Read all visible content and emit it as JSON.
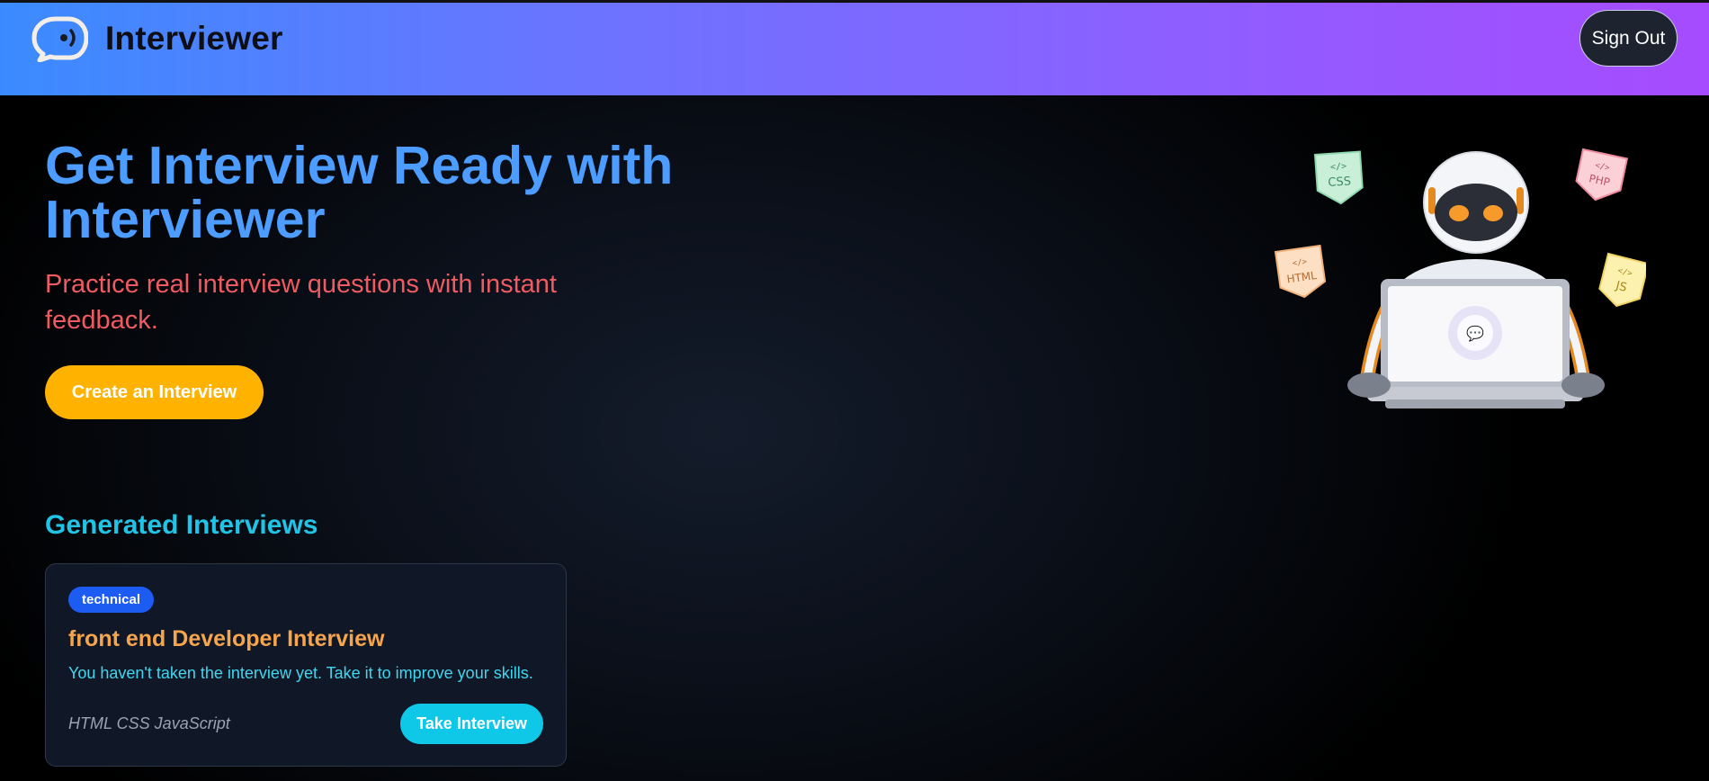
{
  "header": {
    "brand": "Interviewer",
    "sign_out_label": "Sign Out",
    "logo_icon": "chat-bubble-icon"
  },
  "hero": {
    "title": "Get Interview Ready with Interviewer",
    "subtitle": "Practice real interview questions with instant feedback.",
    "cta_label": "Create an Interview",
    "illustration": "robot-with-laptop",
    "tech_tags": [
      "CSS",
      "PHP",
      "HTML",
      "JS"
    ]
  },
  "interviews": {
    "section_title": "Generated Interviews",
    "items": [
      {
        "type": "technical",
        "title": "front end Developer Interview",
        "description": "You haven't taken the interview yet. Take it to improve your skills.",
        "techstack": "HTML CSS JavaScript",
        "action_label": "Take Interview"
      }
    ]
  },
  "colors": {
    "header_gradient_start": "#3b8bff",
    "header_gradient_end": "#a64bff",
    "hero_title": "#4d9cff",
    "hero_subtitle": "#ef5b62",
    "cta": "#ffb300",
    "section_title": "#21c4e6",
    "badge": "#1d5cf2",
    "card_title": "#f7a54c",
    "take_button": "#0fc8e8"
  }
}
